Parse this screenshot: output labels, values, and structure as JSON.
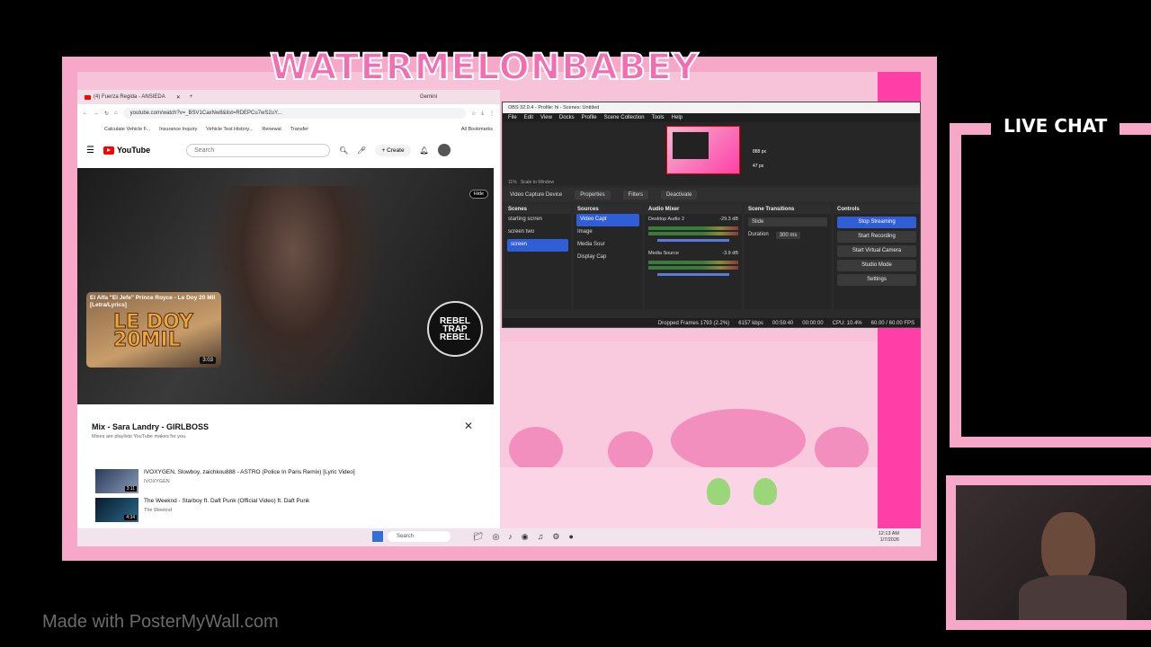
{
  "overlay": {
    "channel_title": "WATERMELONBABEY",
    "chat_title": "LIVE CHAT",
    "watermark": "Made with PosterMyWall.com",
    "colors": {
      "frame_pink": "#f7a8c9",
      "hot_pink": "#ff3fa7",
      "title_pink": "#f06fb0"
    }
  },
  "chrome": {
    "tab_title": "(4) Fuerza Regida - ANSIEDA",
    "gemini": "Gemini",
    "url": "youtube.com/watch?v=_BSV1CaxNw8&list=RDEPCu7wS2uY...",
    "bookmarks": [
      "Calculate Vehicle F...",
      "Insurance Inquiry",
      "Vehicle Test History...",
      "Renewal",
      "Transfer"
    ],
    "all_bookmarks": "All Bookmarks"
  },
  "youtube": {
    "logo": "YouTube",
    "search_placeholder": "Search",
    "create": "Create",
    "notif_count": "9+",
    "hide": "Hide",
    "video_card": {
      "title": "El Alfa \"El Jefe\" Prince Royce - Le Doy 20 Mil [Letra/Lyrics]",
      "art": "LE DOY 20MIL",
      "duration": "3:03"
    },
    "rebel_logo": "REBEL TRAP REBEL",
    "mix": {
      "title": "Mix - Sara Landry - GIRLBOSS",
      "subtitle": "Mixes are playlists YouTube makes for you",
      "items": [
        {
          "title": "IVOXYGEN, Slowboy, zaichkou888 - ASTRO (Police In Paris Remix) [Lyric Video]",
          "channel": "IVOXYGEN",
          "duration": "3:11"
        },
        {
          "title": "The Weeknd - Starboy ft. Daft Punk (Official Video) ft. Daft Punk",
          "channel": "The Weeknd",
          "duration": "4:34"
        }
      ]
    }
  },
  "obs": {
    "title": "OBS 32.0.4 - Profile: hi - Scenes: Untitled",
    "menu": [
      "File",
      "Edit",
      "View",
      "Docks",
      "Profile",
      "Scene Collection",
      "Tools",
      "Help"
    ],
    "preview_px": "888 px",
    "preview_px2": "47 px",
    "zoom": "11%",
    "scale": "Scale to Window",
    "source_name": "Video Capture Device",
    "properties": "Properties",
    "filters": "Filters",
    "deactivate": "Deactivate",
    "scenes_header": "Scenes",
    "scenes": [
      "starting scrren",
      "screen two",
      "screen"
    ],
    "sources_header": "Sources",
    "sources": [
      "Video Capt",
      "Image",
      "Media Sour",
      "Display Cap"
    ],
    "mixer_header": "Audio Mixer",
    "mixer": [
      {
        "name": "Desktop Audio 2",
        "db": "-29.3 dB"
      },
      {
        "name": "Media Source",
        "db": "-3.9 dB"
      }
    ],
    "transitions_header": "Scene Transitions",
    "transition": "Slide",
    "duration_label": "Duration",
    "duration": "300 ms",
    "controls_header": "Controls",
    "controls": [
      "Stop Streaming",
      "Start Recording",
      "Start Virtual Camera",
      "Studio Mode",
      "Settings"
    ],
    "status": {
      "dropped": "Dropped Frames 1793 (2.2%)",
      "kbps": "6157 kbps",
      "live_time": "00:59:40",
      "rec_time": "00:00:00",
      "cpu": "CPU: 10.4%",
      "fps": "60.00 / 60.00 FPS"
    }
  },
  "taskbar": {
    "search": "Search",
    "time": "12:13 AM",
    "date": "1/7/2026"
  }
}
